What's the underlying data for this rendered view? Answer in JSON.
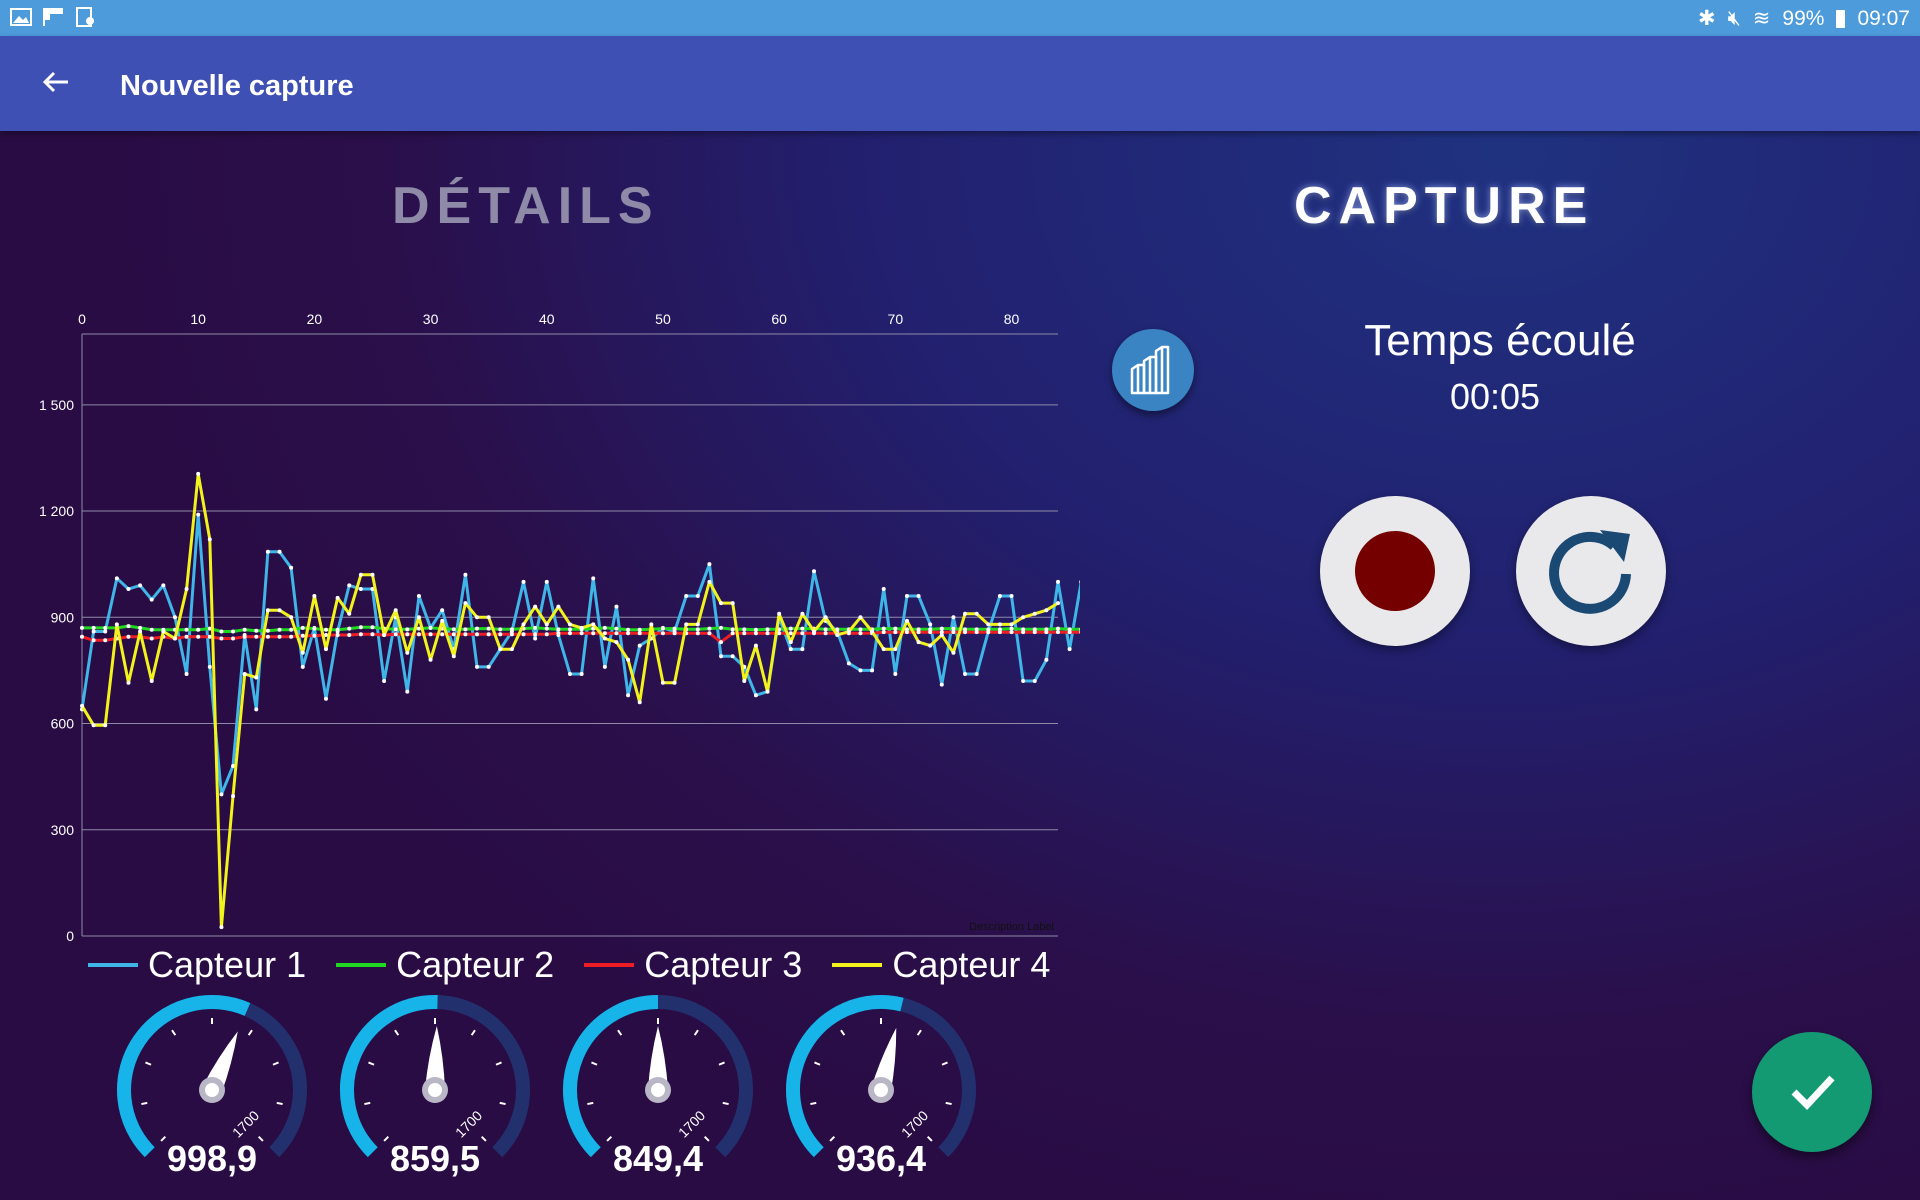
{
  "status_bar": {
    "battery": "99%",
    "time": "09:07"
  },
  "appbar": {
    "title": "Nouvelle capture"
  },
  "tabs": {
    "details": "DÉTAILS",
    "capture": "CAPTURE"
  },
  "capture_panel": {
    "elapsed_label": "Temps écoulé",
    "elapsed_time": "00:05"
  },
  "colors": {
    "appbar": "#3e50b4",
    "status_bar": "#4d9bdb",
    "record": "#750000",
    "confirm": "#149a73",
    "sensor1": "#3fb5e8",
    "sensor2": "#1fd81f",
    "sensor3": "#ee1c25",
    "sensor4": "#f2f21c"
  },
  "chart_data": {
    "type": "line",
    "description_label": "Description Label",
    "xlim": [
      0,
      84
    ],
    "ylim": [
      0,
      1700
    ],
    "x_ticks": [
      "0",
      "10",
      "20",
      "30",
      "40",
      "50",
      "60",
      "70",
      "80"
    ],
    "y_ticks": [
      "0",
      "300",
      "600",
      "900",
      "1 200",
      "1 500"
    ],
    "grid": true,
    "legend_position": "bottom-left",
    "series": [
      {
        "name": "Capteur 1",
        "color": "#3fb5e8",
        "values": [
          640,
          860,
          860,
          1010,
          980,
          990,
          950,
          990,
          900,
          740,
          1190,
          760,
          400,
          480,
          850,
          640,
          1085,
          1085,
          1040,
          760,
          870,
          670,
          860,
          990,
          980,
          980,
          720,
          900,
          690,
          960,
          870,
          920,
          810,
          1020,
          760,
          760,
          810,
          860,
          1000,
          840,
          1000,
          850,
          740,
          740,
          1010,
          760,
          930,
          680,
          820,
          840,
          870,
          860,
          960,
          960,
          1050,
          790,
          790,
          760,
          680,
          690,
          900,
          810,
          810,
          1030,
          890,
          860,
          770,
          750,
          750,
          980,
          740,
          960,
          960,
          880,
          710,
          900,
          740,
          740,
          860,
          960,
          960,
          720,
          720,
          780,
          1000,
          810,
          1000
        ]
      },
      {
        "name": "Capteur 2",
        "color": "#1fd81f",
        "values": [
          870,
          870,
          870,
          870,
          875,
          870,
          865,
          865,
          865,
          865,
          865,
          868,
          860,
          860,
          865,
          862,
          862,
          865,
          865,
          870,
          868,
          865,
          865,
          868,
          872,
          872,
          868,
          866,
          866,
          868,
          870,
          868,
          866,
          866,
          868,
          868,
          866,
          866,
          868,
          870,
          868,
          866,
          866,
          866,
          868,
          870,
          868,
          865,
          865,
          866,
          868,
          868,
          866,
          866,
          868,
          870,
          866,
          866,
          865,
          866,
          866,
          868,
          868,
          868,
          866,
          866,
          866,
          866,
          866,
          868,
          868,
          866,
          866,
          866,
          868,
          868,
          866,
          866,
          866,
          866,
          868,
          866,
          866,
          866,
          868,
          866,
          866
        ]
      },
      {
        "name": "Capteur 3",
        "color": "#ee1c25",
        "values": [
          845,
          835,
          835,
          840,
          845,
          845,
          840,
          845,
          840,
          845,
          845,
          845,
          840,
          840,
          845,
          845,
          845,
          845,
          845,
          848,
          848,
          850,
          850,
          850,
          852,
          852,
          850,
          852,
          852,
          852,
          852,
          852,
          852,
          852,
          852,
          852,
          852,
          852,
          852,
          852,
          852,
          855,
          855,
          855,
          855,
          855,
          855,
          855,
          855,
          855,
          855,
          855,
          855,
          855,
          855,
          830,
          855,
          855,
          855,
          855,
          855,
          855,
          855,
          855,
          855,
          855,
          855,
          855,
          855,
          858,
          858,
          858,
          858,
          858,
          858,
          858,
          858,
          858,
          858,
          858,
          858,
          858,
          858,
          858,
          858,
          858,
          858
        ]
      },
      {
        "name": "Capteur 4",
        "color": "#f2f21c",
        "values": [
          650,
          595,
          595,
          880,
          715,
          860,
          720,
          860,
          840,
          980,
          1305,
          1120,
          25,
          395,
          740,
          730,
          920,
          920,
          900,
          800,
          960,
          810,
          955,
          910,
          1020,
          1020,
          850,
          920,
          800,
          900,
          780,
          890,
          790,
          940,
          900,
          900,
          810,
          810,
          880,
          930,
          880,
          930,
          880,
          870,
          880,
          840,
          830,
          780,
          660,
          880,
          715,
          715,
          880,
          880,
          1000,
          940,
          940,
          720,
          820,
          690,
          910,
          830,
          910,
          860,
          900,
          850,
          860,
          900,
          860,
          810,
          810,
          890,
          830,
          820,
          850,
          800,
          910,
          910,
          880,
          880,
          880,
          900,
          910,
          920,
          940
        ]
      }
    ]
  },
  "gauges": [
    {
      "value": "998,9",
      "max_label": "1700",
      "level": 0.588
    },
    {
      "value": "859,5",
      "max_label": "1700",
      "level": 0.506
    },
    {
      "value": "849,4",
      "max_label": "1700",
      "level": 0.5
    },
    {
      "value": "936,4",
      "max_label": "1700",
      "level": 0.551
    }
  ]
}
